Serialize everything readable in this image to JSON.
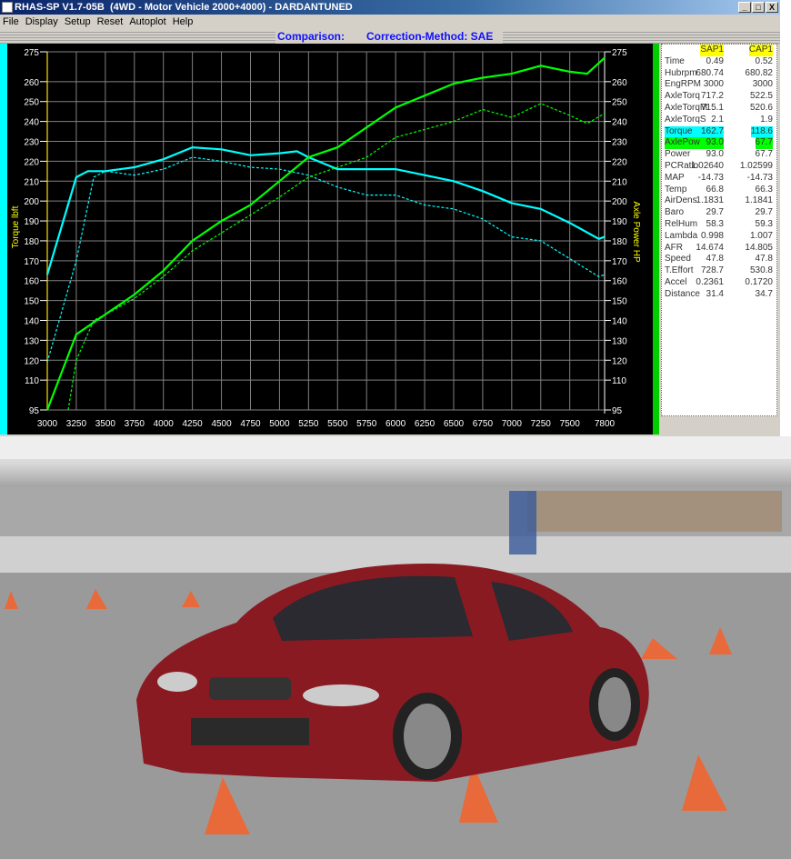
{
  "window": {
    "title": "RHAS-SP V1.7-05B  (4WD - Motor Vehicle 2000+4000) - DARDANTUNED",
    "controls": [
      "_",
      "□",
      "X"
    ]
  },
  "menu": [
    "File",
    "Display",
    "Setup",
    "Reset",
    "Autoplot",
    "Help"
  ],
  "status": {
    "comparison": "Comparison:",
    "method": "Correction-Method: SAE"
  },
  "colors": {
    "torque": "#00ffff",
    "axlepow": "#00ff00",
    "grid": "#808080",
    "axis_label": "#ffff00"
  },
  "table": {
    "headers": [
      "SAP1",
      "CAP1"
    ],
    "rows": [
      [
        "Time",
        "0.49",
        "0.52"
      ],
      [
        "Hubrpm",
        "680.74",
        "680.82"
      ],
      [
        "EngRPM",
        "3000",
        "3000"
      ],
      [
        "AxleTorq",
        "717.2",
        "522.5"
      ],
      [
        "AxleTorqM",
        "715.1",
        "520.6"
      ],
      [
        "AxleTorqS",
        "2.1",
        "1.9"
      ],
      [
        "Torque",
        "162.7",
        "118.6"
      ],
      [
        "AxlePow",
        "93.0",
        "67.7"
      ],
      [
        "Power",
        "93.0",
        "67.7"
      ],
      [
        "PCRatio",
        "1.02640",
        "1.02599"
      ],
      [
        "MAP",
        "-14.73",
        "-14.73"
      ],
      [
        "Temp",
        "66.8",
        "66.3"
      ],
      [
        "AirDens",
        "1.1831",
        "1.1841"
      ],
      [
        "Baro",
        "29.7",
        "29.7"
      ],
      [
        "RelHum",
        "58.3",
        "59.3"
      ],
      [
        "Lambda",
        "0.998",
        "1.007"
      ],
      [
        "AFR",
        "14.674",
        "14.805"
      ],
      [
        "Speed",
        "47.8",
        "47.8"
      ],
      [
        "T.Effort",
        "728.7",
        "530.8"
      ],
      [
        "Accel",
        "0.2361",
        "0.1720"
      ],
      [
        "Distance",
        "31.4",
        "34.7"
      ]
    ]
  },
  "chart_data": {
    "type": "line",
    "ylabel": "Torque lbft",
    "y2label": "Axle Power HP",
    "xlim": [
      3000,
      7800
    ],
    "ylim": [
      95,
      275
    ],
    "y2lim": [
      95,
      275
    ],
    "grid": true,
    "xticks": [
      3000,
      3250,
      3500,
      3750,
      4000,
      4250,
      4500,
      4750,
      5000,
      5250,
      5500,
      5750,
      6000,
      6250,
      6500,
      6750,
      7000,
      7250,
      7500,
      7800
    ],
    "yticks": [
      95,
      110,
      120,
      130,
      140,
      150,
      160,
      170,
      180,
      190,
      200,
      210,
      220,
      230,
      240,
      250,
      260,
      275
    ],
    "series": [
      {
        "name": "Torque",
        "run": "SAP1",
        "style": "solid",
        "color": "#00ffff",
        "x": [
          3000,
          3250,
          3350,
          3500,
          3750,
          4000,
          4250,
          4500,
          4750,
          5000,
          5150,
          5250,
          5500,
          5750,
          6000,
          6250,
          6500,
          6750,
          7000,
          7250,
          7500,
          7750,
          7800
        ],
        "y": [
          163,
          212,
          215,
          215,
          217,
          221,
          227,
          226,
          223,
          224,
          225,
          222,
          216,
          216,
          216,
          213,
          210,
          205,
          199,
          196,
          189,
          181,
          182
        ]
      },
      {
        "name": "Torque",
        "run": "CAP1",
        "style": "dashed",
        "color": "#00ffff",
        "x": [
          3000,
          3250,
          3400,
          3500,
          3750,
          4000,
          4250,
          4500,
          4750,
          5000,
          5250,
          5500,
          5750,
          6000,
          6250,
          6500,
          6750,
          7000,
          7250,
          7500,
          7750,
          7800
        ],
        "y": [
          119,
          170,
          212,
          215,
          213,
          216,
          222,
          220,
          217,
          216,
          213,
          207,
          203,
          203,
          198,
          196,
          191,
          182,
          180,
          171,
          162,
          163
        ]
      },
      {
        "name": "AxlePow",
        "run": "SAP1",
        "style": "solid",
        "color": "#00ff00",
        "x": [
          3000,
          3250,
          3500,
          3750,
          4000,
          4250,
          4500,
          4750,
          5000,
          5250,
          5500,
          5750,
          6000,
          6250,
          6500,
          6750,
          7000,
          7250,
          7500,
          7650,
          7800
        ],
        "y": [
          95,
          133,
          143,
          153,
          165,
          180,
          190,
          198,
          210,
          222,
          227,
          237,
          247,
          253,
          259,
          262,
          264,
          268,
          265,
          264,
          272
        ]
      },
      {
        "name": "AxlePow",
        "run": "CAP1",
        "style": "dashed",
        "color": "#00ff00",
        "x": [
          3180,
          3250,
          3400,
          3500,
          3750,
          4000,
          4250,
          4500,
          4750,
          5000,
          5250,
          5500,
          5750,
          6000,
          6250,
          6500,
          6750,
          7000,
          7250,
          7500,
          7650,
          7800
        ],
        "y": [
          95,
          120,
          140,
          143,
          151,
          162,
          175,
          184,
          193,
          202,
          212,
          217,
          222,
          232,
          236,
          240,
          246,
          242,
          249,
          243,
          239,
          244
        ]
      }
    ]
  }
}
